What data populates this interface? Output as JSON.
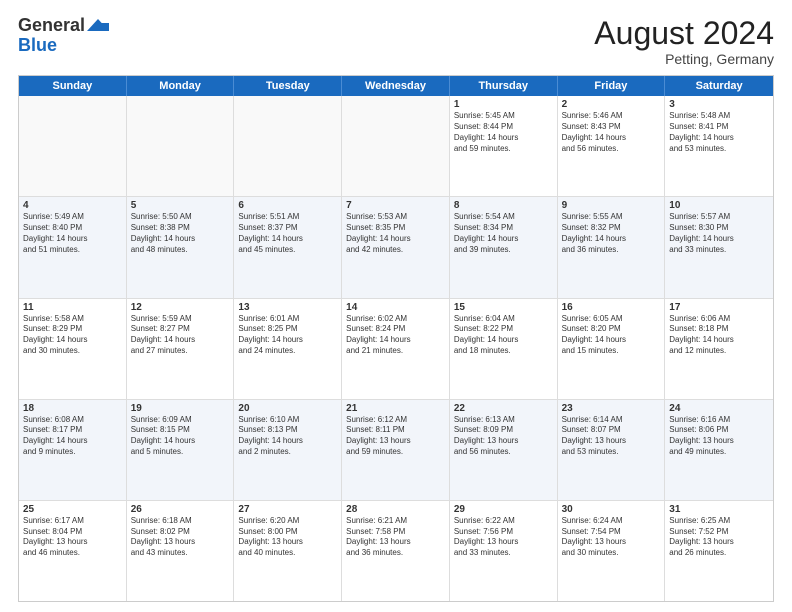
{
  "header": {
    "logo_general": "General",
    "logo_blue": "Blue",
    "month_year": "August 2024",
    "location": "Petting, Germany"
  },
  "days_of_week": [
    "Sunday",
    "Monday",
    "Tuesday",
    "Wednesday",
    "Thursday",
    "Friday",
    "Saturday"
  ],
  "rows": [
    {
      "alt": false,
      "cells": [
        {
          "day": "",
          "data": ""
        },
        {
          "day": "",
          "data": ""
        },
        {
          "day": "",
          "data": ""
        },
        {
          "day": "",
          "data": ""
        },
        {
          "day": "1",
          "data": "Sunrise: 5:45 AM\nSunset: 8:44 PM\nDaylight: 14 hours\nand 59 minutes."
        },
        {
          "day": "2",
          "data": "Sunrise: 5:46 AM\nSunset: 8:43 PM\nDaylight: 14 hours\nand 56 minutes."
        },
        {
          "day": "3",
          "data": "Sunrise: 5:48 AM\nSunset: 8:41 PM\nDaylight: 14 hours\nand 53 minutes."
        }
      ]
    },
    {
      "alt": true,
      "cells": [
        {
          "day": "4",
          "data": "Sunrise: 5:49 AM\nSunset: 8:40 PM\nDaylight: 14 hours\nand 51 minutes."
        },
        {
          "day": "5",
          "data": "Sunrise: 5:50 AM\nSunset: 8:38 PM\nDaylight: 14 hours\nand 48 minutes."
        },
        {
          "day": "6",
          "data": "Sunrise: 5:51 AM\nSunset: 8:37 PM\nDaylight: 14 hours\nand 45 minutes."
        },
        {
          "day": "7",
          "data": "Sunrise: 5:53 AM\nSunset: 8:35 PM\nDaylight: 14 hours\nand 42 minutes."
        },
        {
          "day": "8",
          "data": "Sunrise: 5:54 AM\nSunset: 8:34 PM\nDaylight: 14 hours\nand 39 minutes."
        },
        {
          "day": "9",
          "data": "Sunrise: 5:55 AM\nSunset: 8:32 PM\nDaylight: 14 hours\nand 36 minutes."
        },
        {
          "day": "10",
          "data": "Sunrise: 5:57 AM\nSunset: 8:30 PM\nDaylight: 14 hours\nand 33 minutes."
        }
      ]
    },
    {
      "alt": false,
      "cells": [
        {
          "day": "11",
          "data": "Sunrise: 5:58 AM\nSunset: 8:29 PM\nDaylight: 14 hours\nand 30 minutes."
        },
        {
          "day": "12",
          "data": "Sunrise: 5:59 AM\nSunset: 8:27 PM\nDaylight: 14 hours\nand 27 minutes."
        },
        {
          "day": "13",
          "data": "Sunrise: 6:01 AM\nSunset: 8:25 PM\nDaylight: 14 hours\nand 24 minutes."
        },
        {
          "day": "14",
          "data": "Sunrise: 6:02 AM\nSunset: 8:24 PM\nDaylight: 14 hours\nand 21 minutes."
        },
        {
          "day": "15",
          "data": "Sunrise: 6:04 AM\nSunset: 8:22 PM\nDaylight: 14 hours\nand 18 minutes."
        },
        {
          "day": "16",
          "data": "Sunrise: 6:05 AM\nSunset: 8:20 PM\nDaylight: 14 hours\nand 15 minutes."
        },
        {
          "day": "17",
          "data": "Sunrise: 6:06 AM\nSunset: 8:18 PM\nDaylight: 14 hours\nand 12 minutes."
        }
      ]
    },
    {
      "alt": true,
      "cells": [
        {
          "day": "18",
          "data": "Sunrise: 6:08 AM\nSunset: 8:17 PM\nDaylight: 14 hours\nand 9 minutes."
        },
        {
          "day": "19",
          "data": "Sunrise: 6:09 AM\nSunset: 8:15 PM\nDaylight: 14 hours\nand 5 minutes."
        },
        {
          "day": "20",
          "data": "Sunrise: 6:10 AM\nSunset: 8:13 PM\nDaylight: 14 hours\nand 2 minutes."
        },
        {
          "day": "21",
          "data": "Sunrise: 6:12 AM\nSunset: 8:11 PM\nDaylight: 13 hours\nand 59 minutes."
        },
        {
          "day": "22",
          "data": "Sunrise: 6:13 AM\nSunset: 8:09 PM\nDaylight: 13 hours\nand 56 minutes."
        },
        {
          "day": "23",
          "data": "Sunrise: 6:14 AM\nSunset: 8:07 PM\nDaylight: 13 hours\nand 53 minutes."
        },
        {
          "day": "24",
          "data": "Sunrise: 6:16 AM\nSunset: 8:06 PM\nDaylight: 13 hours\nand 49 minutes."
        }
      ]
    },
    {
      "alt": false,
      "cells": [
        {
          "day": "25",
          "data": "Sunrise: 6:17 AM\nSunset: 8:04 PM\nDaylight: 13 hours\nand 46 minutes."
        },
        {
          "day": "26",
          "data": "Sunrise: 6:18 AM\nSunset: 8:02 PM\nDaylight: 13 hours\nand 43 minutes."
        },
        {
          "day": "27",
          "data": "Sunrise: 6:20 AM\nSunset: 8:00 PM\nDaylight: 13 hours\nand 40 minutes."
        },
        {
          "day": "28",
          "data": "Sunrise: 6:21 AM\nSunset: 7:58 PM\nDaylight: 13 hours\nand 36 minutes."
        },
        {
          "day": "29",
          "data": "Sunrise: 6:22 AM\nSunset: 7:56 PM\nDaylight: 13 hours\nand 33 minutes."
        },
        {
          "day": "30",
          "data": "Sunrise: 6:24 AM\nSunset: 7:54 PM\nDaylight: 13 hours\nand 30 minutes."
        },
        {
          "day": "31",
          "data": "Sunrise: 6:25 AM\nSunset: 7:52 PM\nDaylight: 13 hours\nand 26 minutes."
        }
      ]
    }
  ]
}
